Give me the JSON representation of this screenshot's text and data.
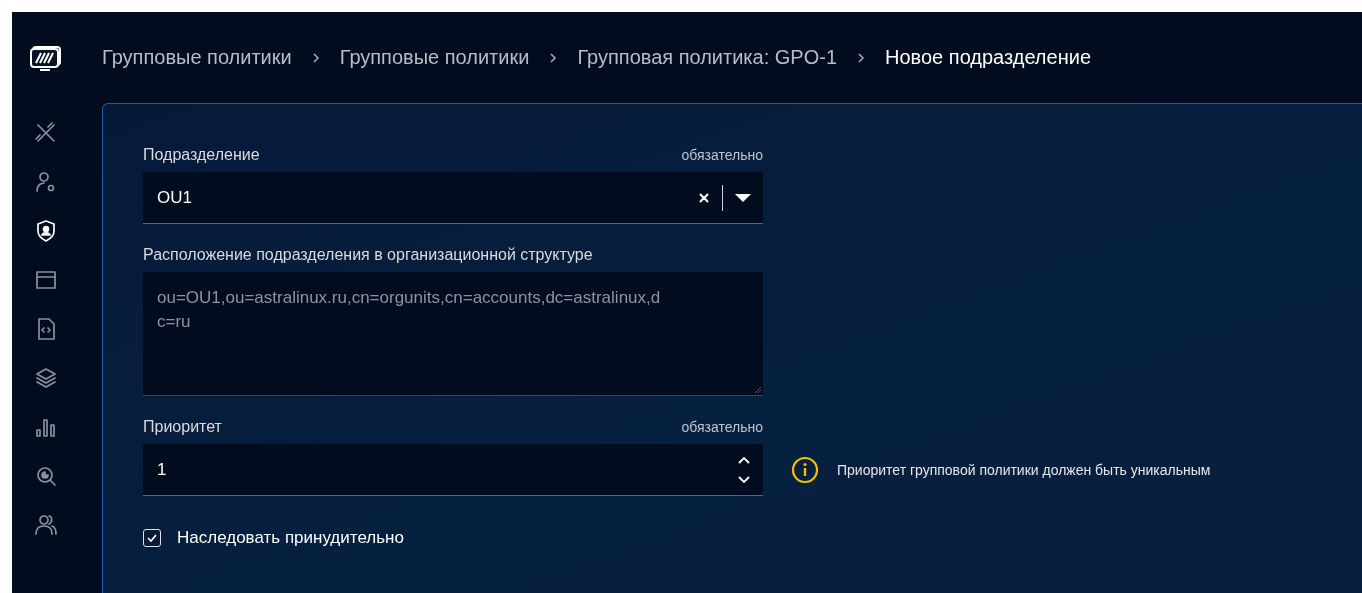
{
  "sidebar": {
    "items": [
      {
        "kind": "tools",
        "selected": false
      },
      {
        "kind": "user-gear",
        "selected": false
      },
      {
        "kind": "shield-user",
        "selected": true
      },
      {
        "kind": "window",
        "selected": false
      },
      {
        "kind": "code-file",
        "selected": false
      },
      {
        "kind": "layers",
        "selected": false
      },
      {
        "kind": "bars",
        "selected": false
      },
      {
        "kind": "search",
        "selected": false
      },
      {
        "kind": "users",
        "selected": false
      }
    ]
  },
  "breadcrumbs": [
    {
      "label": "Групповые политики",
      "current": false
    },
    {
      "label": "Групповые политики",
      "current": false
    },
    {
      "label": "Групповая политика: GPO-1",
      "current": false
    },
    {
      "label": "Новое подразделение",
      "current": true
    }
  ],
  "form": {
    "fields": [
      {
        "kind": "select",
        "label": "Подразделение",
        "required": "обязательно",
        "value": "OU1"
      },
      {
        "kind": "textarea",
        "label": "Расположение подразделения в организационной структуре",
        "value": "ou=OU1,ou=astralinux.ru,cn=orgunits,cn=accounts,dc=astralinux,dc=ru"
      },
      {
        "kind": "number",
        "label": "Приоритет",
        "required": "обязательно",
        "value": "1",
        "hint": "Приоритет групповой политики должен быть уникальным"
      },
      {
        "kind": "checkbox",
        "label": "Наследовать принудительно",
        "checked": true
      }
    ]
  }
}
